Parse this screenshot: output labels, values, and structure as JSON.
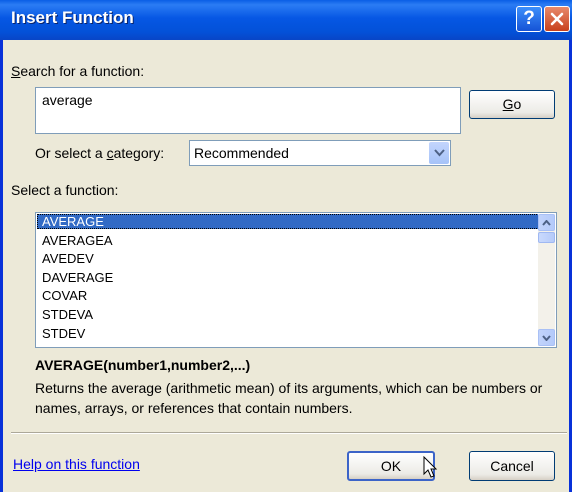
{
  "title": "Insert Function",
  "titlebar": {
    "help_label": "?"
  },
  "search": {
    "label": "Search for a function:",
    "value": "average"
  },
  "go_button": "Go",
  "category": {
    "label": "Or select a category:",
    "value": "Recommended"
  },
  "function_list": {
    "label": "Select a function:",
    "items": [
      "AVERAGE",
      "AVERAGEA",
      "AVEDEV",
      "DAVERAGE",
      "COVAR",
      "STDEVA",
      "STDEV"
    ],
    "selected": "AVERAGE"
  },
  "syntax": "AVERAGE(number1,number2,...)",
  "description": "Returns the average (arithmetic mean) of its arguments, which can be numbers or names, arrays, or references that contain numbers.",
  "help_link": "Help on this function",
  "ok_button": "OK",
  "cancel_button": "Cancel",
  "icons": {
    "help": "help-icon",
    "close": "close-icon",
    "dropdown": "chevron-down-icon",
    "scroll_up": "chevron-up-icon",
    "scroll_down": "chevron-down-icon",
    "cursor": "mouse-pointer-icon"
  },
  "colors": {
    "titlebar": "#0657e4",
    "selection": "#316ac5",
    "dialog_bg": "#ece9d8",
    "link": "#0000ee"
  }
}
